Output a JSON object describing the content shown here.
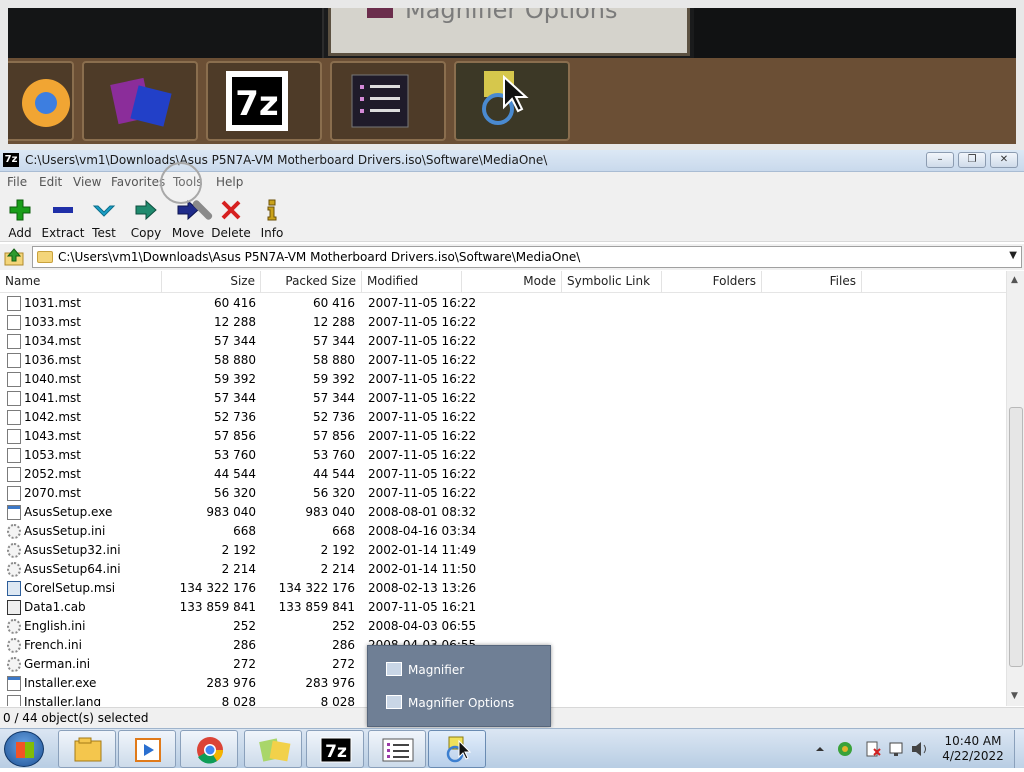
{
  "magnifier_view": {
    "zoomed_tab_label": "Magnifier Options",
    "tiles": [
      "chrome-icon",
      "winrar-icon",
      "7zip-icon",
      "menu-list-icon",
      "magnifier-icon"
    ]
  },
  "window": {
    "app_icon_text": "7z",
    "title": "C:\\Users\\vm1\\Downloads\\Asus P5N7A-VM Motherboard Drivers.iso\\Software\\MediaOne\\",
    "minimize_icon": "minimize-icon",
    "restore_icon": "restore-icon",
    "close_icon": "close-icon"
  },
  "menu": [
    "File",
    "Edit",
    "View",
    "Favorites",
    "Tools",
    "Help"
  ],
  "toolbar": {
    "add": "Add",
    "extract": "Extract",
    "test": "Test",
    "copy": "Copy",
    "move": "Move",
    "delete": "Delete",
    "info": "Info"
  },
  "address": {
    "path": "C:\\Users\\vm1\\Downloads\\Asus P5N7A-VM Motherboard Drivers.iso\\Software\\MediaOne\\"
  },
  "columns": {
    "name": "Name",
    "size": "Size",
    "packed": "Packed Size",
    "modified": "Modified",
    "mode": "Mode",
    "symlink": "Symbolic Link",
    "folders": "Folders",
    "files": "Files"
  },
  "files": [
    {
      "name": "1031.mst",
      "size": "60 416",
      "packed": "60 416",
      "modified": "2007-11-05 16:22",
      "icon": "doc"
    },
    {
      "name": "1033.mst",
      "size": "12 288",
      "packed": "12 288",
      "modified": "2007-11-05 16:22",
      "icon": "doc"
    },
    {
      "name": "1034.mst",
      "size": "57 344",
      "packed": "57 344",
      "modified": "2007-11-05 16:22",
      "icon": "doc"
    },
    {
      "name": "1036.mst",
      "size": "58 880",
      "packed": "58 880",
      "modified": "2007-11-05 16:22",
      "icon": "doc"
    },
    {
      "name": "1040.mst",
      "size": "59 392",
      "packed": "59 392",
      "modified": "2007-11-05 16:22",
      "icon": "doc"
    },
    {
      "name": "1041.mst",
      "size": "57 344",
      "packed": "57 344",
      "modified": "2007-11-05 16:22",
      "icon": "doc"
    },
    {
      "name": "1042.mst",
      "size": "52 736",
      "packed": "52 736",
      "modified": "2007-11-05 16:22",
      "icon": "doc"
    },
    {
      "name": "1043.mst",
      "size": "57 856",
      "packed": "57 856",
      "modified": "2007-11-05 16:22",
      "icon": "doc"
    },
    {
      "name": "1053.mst",
      "size": "53 760",
      "packed": "53 760",
      "modified": "2007-11-05 16:22",
      "icon": "doc"
    },
    {
      "name": "2052.mst",
      "size": "44 544",
      "packed": "44 544",
      "modified": "2007-11-05 16:22",
      "icon": "doc"
    },
    {
      "name": "2070.mst",
      "size": "56 320",
      "packed": "56 320",
      "modified": "2007-11-05 16:22",
      "icon": "doc"
    },
    {
      "name": "AsusSetup.exe",
      "size": "983 040",
      "packed": "983 040",
      "modified": "2008-08-01 08:32",
      "icon": "exe"
    },
    {
      "name": "AsusSetup.ini",
      "size": "668",
      "packed": "668",
      "modified": "2008-04-16 03:34",
      "icon": "ini"
    },
    {
      "name": "AsusSetup32.ini",
      "size": "2 192",
      "packed": "2 192",
      "modified": "2002-01-14 11:49",
      "icon": "ini"
    },
    {
      "name": "AsusSetup64.ini",
      "size": "2 214",
      "packed": "2 214",
      "modified": "2002-01-14 11:50",
      "icon": "ini"
    },
    {
      "name": "CorelSetup.msi",
      "size": "134 322 176",
      "packed": "134 322 176",
      "modified": "2008-02-13 13:26",
      "icon": "msi"
    },
    {
      "name": "Data1.cab",
      "size": "133 859 841",
      "packed": "133 859 841",
      "modified": "2007-11-05 16:21",
      "icon": "cab"
    },
    {
      "name": "English.ini",
      "size": "252",
      "packed": "252",
      "modified": "2008-04-03 06:55",
      "icon": "ini"
    },
    {
      "name": "French.ini",
      "size": "286",
      "packed": "286",
      "modified": "2008-04-03 06:55",
      "icon": "ini"
    },
    {
      "name": "German.ini",
      "size": "272",
      "packed": "272",
      "modified": "",
      "icon": "ini"
    },
    {
      "name": "Installer.exe",
      "size": "283 976",
      "packed": "283 976",
      "modified": "",
      "icon": "exe"
    },
    {
      "name": "Installer.lang",
      "size": "8 028",
      "packed": "8 028",
      "modified": "",
      "icon": "doc"
    }
  ],
  "status": {
    "selection": "0 / 44 object(s) selected"
  },
  "jumplist": {
    "item1": "Magnifier",
    "item2": "Magnifier Options"
  },
  "taskbar": {
    "start_icon": "windows-start-icon",
    "buttons": [
      "file-explorer-icon",
      "media-player-icon",
      "chrome-icon",
      "winrar-icon",
      "7zip-icon",
      "menu-list-icon",
      "magnifier-icon"
    ],
    "active_button": "magnifier-icon",
    "time": "10:40 AM",
    "date": "4/22/2022"
  },
  "colors": {
    "add": "#1a9e1a",
    "extract": "#1f2fa8",
    "test": "#1aa0c8",
    "copy": "#1f8a6e",
    "move": "#1f2b8a",
    "delete": "#d62020",
    "info": "#caa21a",
    "jumplist_bg": "#6f7f95"
  }
}
